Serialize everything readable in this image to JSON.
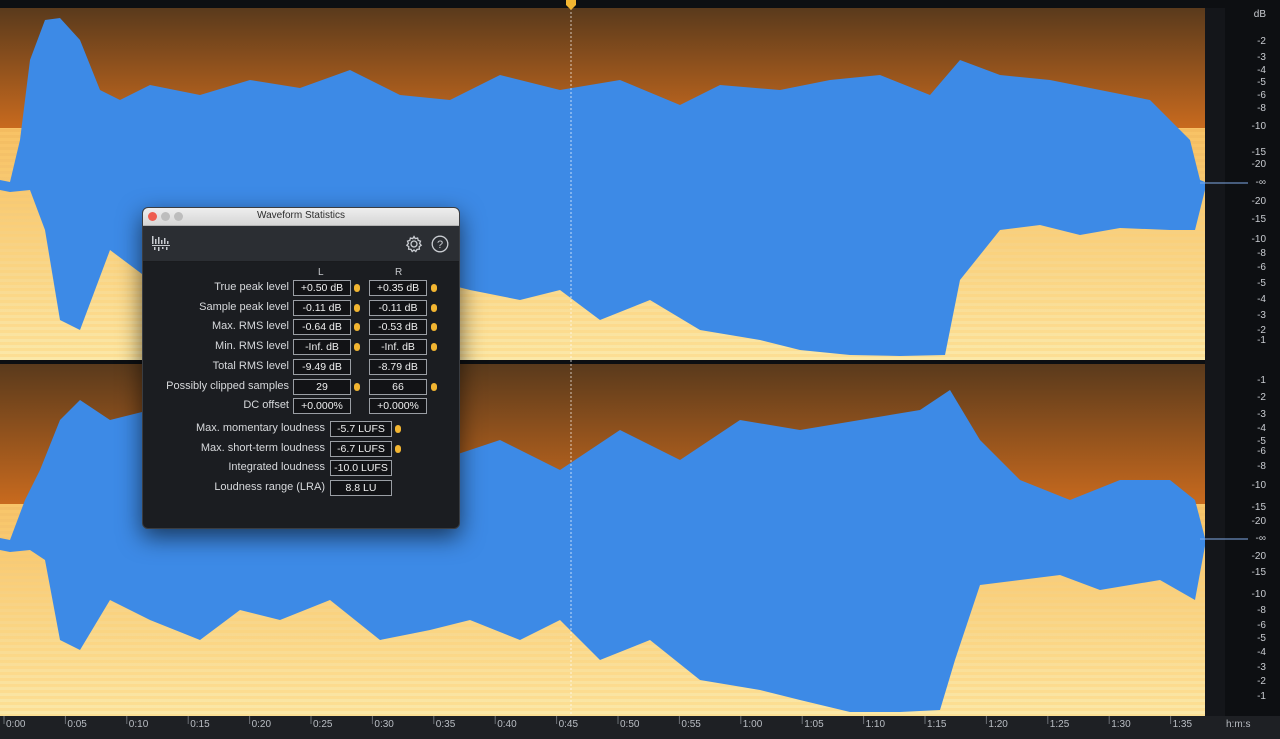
{
  "colors": {
    "waveform_blue": "#3d8ae6",
    "spectrum_orange": "#e88d2a",
    "background": "#0d0f12",
    "playhead": "#f2b531"
  },
  "ruler": {
    "db_unit": "dB",
    "db_labels_top": [
      "-2",
      "-3",
      "-4",
      "-5",
      "-6",
      "-8",
      "-10",
      "-15",
      "-20",
      "-∞",
      "-20",
      "-15",
      "-10",
      "-8",
      "-6",
      "-5",
      "-4",
      "-3",
      "-2",
      "-1"
    ],
    "db_labels_bottom": [
      "-1",
      "-2",
      "-3",
      "-4",
      "-5",
      "-6",
      "-8",
      "-10",
      "-15",
      "-20",
      "-∞",
      "-20",
      "-15",
      "-10",
      "-8",
      "-6",
      "-5",
      "-4",
      "-3",
      "-2",
      "-1"
    ],
    "time_labels": [
      "0:00",
      "0:05",
      "0:10",
      "0:15",
      "0:20",
      "0:25",
      "0:30",
      "0:35",
      "0:40",
      "0:45",
      "0:50",
      "0:55",
      "1:00",
      "1:05",
      "1:10",
      "1:15",
      "1:20",
      "1:25",
      "1:30",
      "1:35"
    ],
    "time_unit": "h:m:s"
  },
  "dialog": {
    "title": "Waveform Statistics",
    "settings_icon": "gear-icon",
    "help_icon": "question-icon",
    "col_left": "L",
    "col_right": "R",
    "rows": [
      {
        "label": "True peak level",
        "left": "+0.50 dB",
        "right": "+0.35 dB",
        "left_pin": true,
        "right_pin": true
      },
      {
        "label": "Sample peak level",
        "left": "-0.11 dB",
        "right": "-0.11 dB",
        "left_pin": true,
        "right_pin": true
      },
      {
        "label": "Max. RMS level",
        "left": "-0.64 dB",
        "right": "-0.53 dB",
        "left_pin": true,
        "right_pin": true
      },
      {
        "label": "Min. RMS level",
        "left": "-Inf. dB",
        "right": "-Inf. dB",
        "left_pin": true,
        "right_pin": true
      },
      {
        "label": "Total RMS level",
        "left": "-9.49 dB",
        "right": "-8.79 dB",
        "left_pin": false,
        "right_pin": false
      },
      {
        "label": "Possibly clipped samples",
        "left": "29",
        "right": "66",
        "left_pin": true,
        "right_pin": true
      },
      {
        "label": "DC offset",
        "left": "+0.000%",
        "right": "+0.000%",
        "left_pin": false,
        "right_pin": false
      }
    ],
    "loudness": [
      {
        "label": "Max. momentary loudness",
        "value": "-5.7 LUFS",
        "pin": true
      },
      {
        "label": "Max. short-term loudness",
        "value": "-6.7 LUFS",
        "pin": true
      },
      {
        "label": "Integrated loudness",
        "value": "-10.0 LUFS",
        "pin": false
      },
      {
        "label": "Loudness range (LRA)",
        "value": "8.8 LU",
        "pin": false
      }
    ]
  }
}
